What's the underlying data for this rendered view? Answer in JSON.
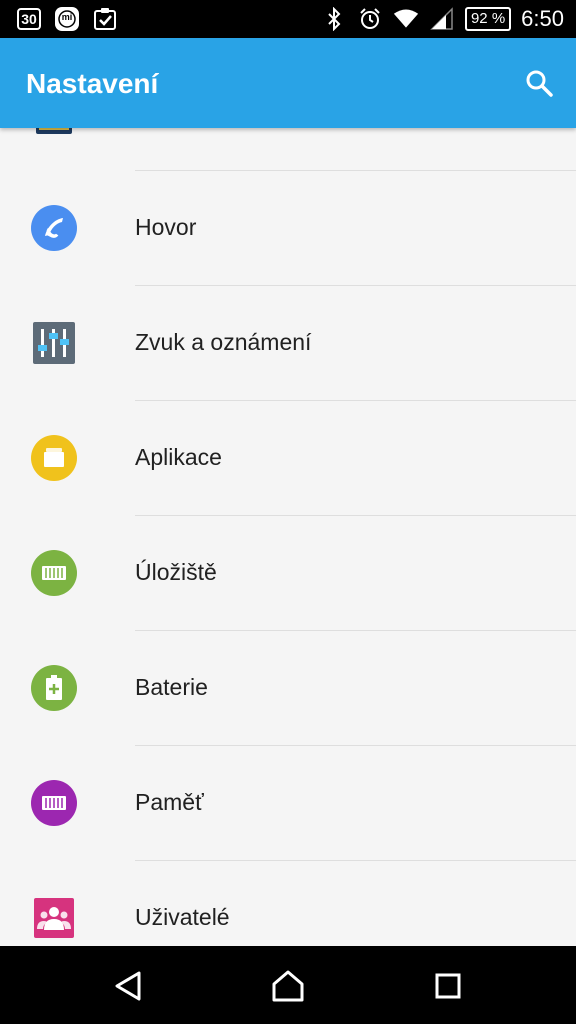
{
  "status_bar": {
    "calendar_day": "30",
    "mi_label": "mi",
    "battery": "92 %",
    "time": "6:50"
  },
  "app_bar": {
    "title": "Nastavení"
  },
  "settings": [
    {
      "label": "Hovor",
      "icon": "phone-icon"
    },
    {
      "label": "Zvuk a oznámení",
      "icon": "sound-sliders-icon"
    },
    {
      "label": "Aplikace",
      "icon": "apps-icon"
    },
    {
      "label": "Úložiště",
      "icon": "storage-icon"
    },
    {
      "label": "Baterie",
      "icon": "battery-icon"
    },
    {
      "label": "Paměť",
      "icon": "memory-icon"
    },
    {
      "label": "Uživatelé",
      "icon": "users-icon"
    }
  ],
  "colors": {
    "app_bar": "#29a3e6",
    "phone": "#4a8ef0",
    "sound": "#5d6b78",
    "apps": "#f0c21c",
    "storage": "#7cb342",
    "battery": "#7cb342",
    "memory": "#9c27b0",
    "users": "#d6337e"
  }
}
